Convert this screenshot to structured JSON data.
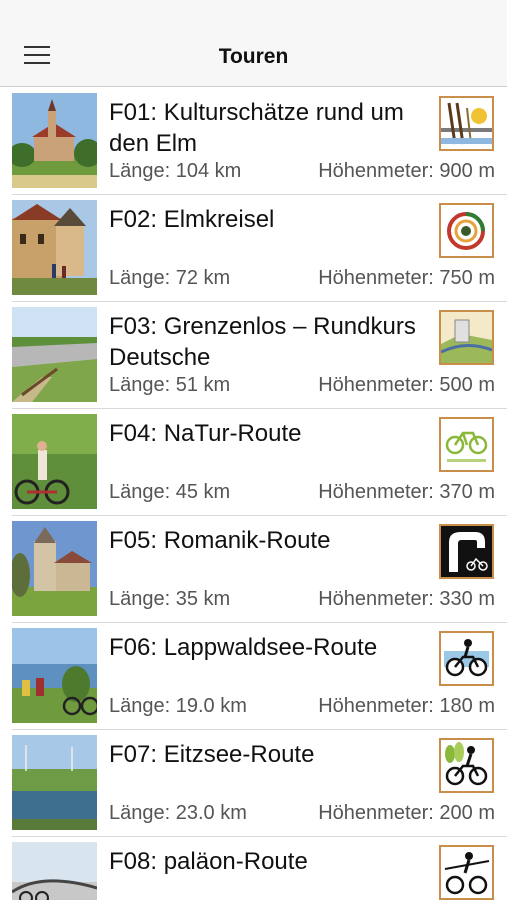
{
  "header": {
    "title": "Touren",
    "menu_icon": "hamburger-menu-icon"
  },
  "tours": [
    {
      "title": "F01: Kulturschätze rund um den Elm",
      "length": "Länge: 104 km",
      "elevation": "Höhenmeter: 900 m",
      "logo_icon": "bridge-sun-icon"
    },
    {
      "title": "F02: Elmkreisel",
      "length": "Länge: 72 km",
      "elevation": "Höhenmeter: 750 m",
      "logo_icon": "circle-swirl-icon"
    },
    {
      "title": "F03: Grenzenlos – Rundkurs Deutsche",
      "length": "Länge: 51 km",
      "elevation": "Höhenmeter: 500 m",
      "logo_icon": "tower-landscape-icon"
    },
    {
      "title": "F04: NaTur-Route",
      "length": "Länge: 45 km",
      "elevation": "Höhenmeter: 370 m",
      "logo_icon": "green-bicycle-icon"
    },
    {
      "title": "F05: Romanik-Route",
      "length": "Länge: 35 km",
      "elevation": "Höhenmeter: 330 m",
      "logo_icon": "arch-bicycle-icon"
    },
    {
      "title": "F06: Lappwaldsee-Route",
      "length": "Länge: 19.0 km",
      "elevation": "Höhenmeter: 180 m",
      "logo_icon": "cyclist-lake-icon"
    },
    {
      "title": "F07: Eitzsee-Route",
      "length": "Länge: 23.0 km",
      "elevation": "Höhenmeter: 200 m",
      "logo_icon": "cyclist-trees-icon"
    },
    {
      "title": "F08: paläon-Route",
      "length": "",
      "elevation": "",
      "logo_icon": "cyclist-spear-icon"
    }
  ]
}
